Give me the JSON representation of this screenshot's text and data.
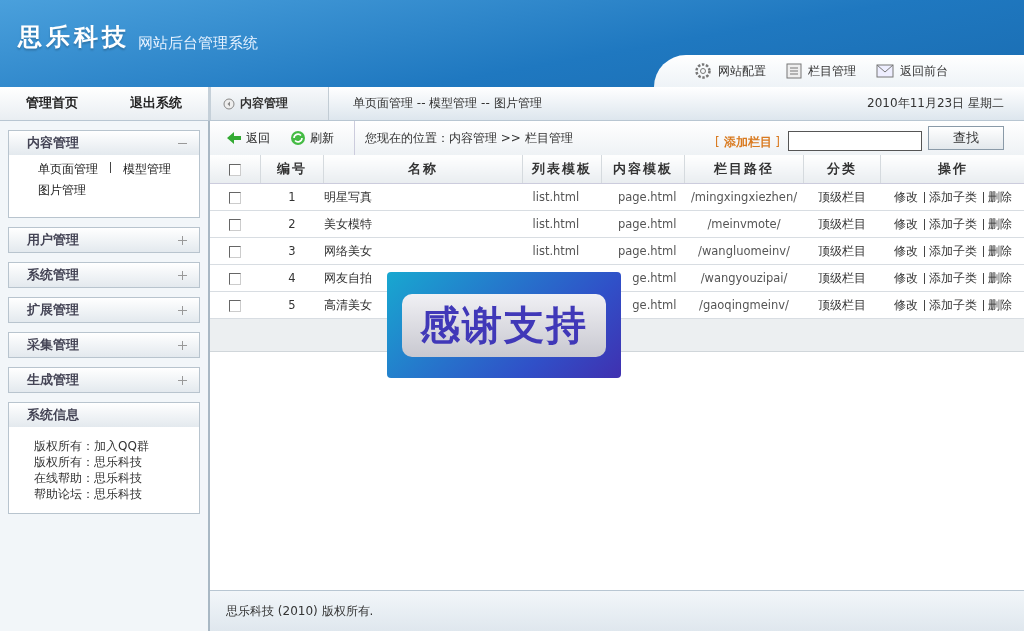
{
  "brand": {
    "logo": "思乐科技",
    "subtitle": "网站后台管理系统"
  },
  "top_links": [
    {
      "kind": "gear",
      "label": "网站配置"
    },
    {
      "kind": "list",
      "label": "栏目管理"
    },
    {
      "kind": "mail",
      "label": "返回前台"
    }
  ],
  "nav": {
    "links": [
      "管理首页",
      "退出系统"
    ],
    "section": "内容管理",
    "crumbs": "单页面管理 -- 模型管理 -- 图片管理",
    "date": "2010年11月23日 星期二"
  },
  "sidebar": {
    "panels": [
      {
        "title": "内容管理",
        "expanded": true,
        "items": [
          "单页面管理",
          "模型管理",
          "图片管理"
        ]
      },
      {
        "title": "用户管理",
        "expanded": false
      },
      {
        "title": "系统管理",
        "expanded": false
      },
      {
        "title": "扩展管理",
        "expanded": false
      },
      {
        "title": "采集管理",
        "expanded": false
      },
      {
        "title": "生成管理",
        "expanded": false
      }
    ],
    "info": {
      "title": "系统信息",
      "lines": [
        "版权所有：加入QQ群",
        "版权所有：思乐科技",
        "在线帮助：思乐科技",
        "帮助论坛：思乐科技"
      ]
    }
  },
  "toolbar": {
    "back": "返回",
    "refresh": "刷新",
    "location": "您现在的位置：内容管理 >> 栏目管理",
    "add": "[ **添加栏目** ]",
    "search_button": "查找"
  },
  "table": {
    "select_all_checked": false,
    "columns": [
      "编号",
      "名称",
      "列表模板",
      "内容模板",
      "栏目路径",
      "分类",
      "操作"
    ],
    "rows": [
      {
        "checked": false,
        "id": "1",
        "name": "明星写真",
        "list": "list.html",
        "content": "page.html",
        "path": "/mingxingxiezhen/",
        "category": "顶级栏目"
      },
      {
        "checked": false,
        "id": "2",
        "name": "美女模特",
        "list": "list.html",
        "content": "page.html",
        "path": "/meinvmote/",
        "category": "顶级栏目"
      },
      {
        "checked": false,
        "id": "3",
        "name": "网络美女",
        "list": "list.html",
        "content": "page.html",
        "path": "/wangluomeinv/",
        "category": "顶级栏目"
      },
      {
        "checked": false,
        "id": "4",
        "name": "网友自拍",
        "content": "ge.html",
        "path": "/wangyouzipai/",
        "category": "顶级栏目"
      },
      {
        "checked": false,
        "id": "5",
        "name": "高清美女",
        "content": "ge.html",
        "path": "/gaoqingmeinv/",
        "category": "顶级栏目"
      }
    ],
    "actions": [
      [
        "修改",
        "添加子类",
        "删除"
      ],
      [
        "修改",
        "添加子类",
        "删除"
      ],
      [
        "修改",
        "添加子类",
        "删除"
      ],
      [
        "修改",
        "添加子类",
        "删除"
      ],
      [
        "修改",
        "添加子类",
        "删除"
      ]
    ]
  },
  "overlay_banner": "感谢支持",
  "footer": "思乐科技 (2010) 版权所有."
}
